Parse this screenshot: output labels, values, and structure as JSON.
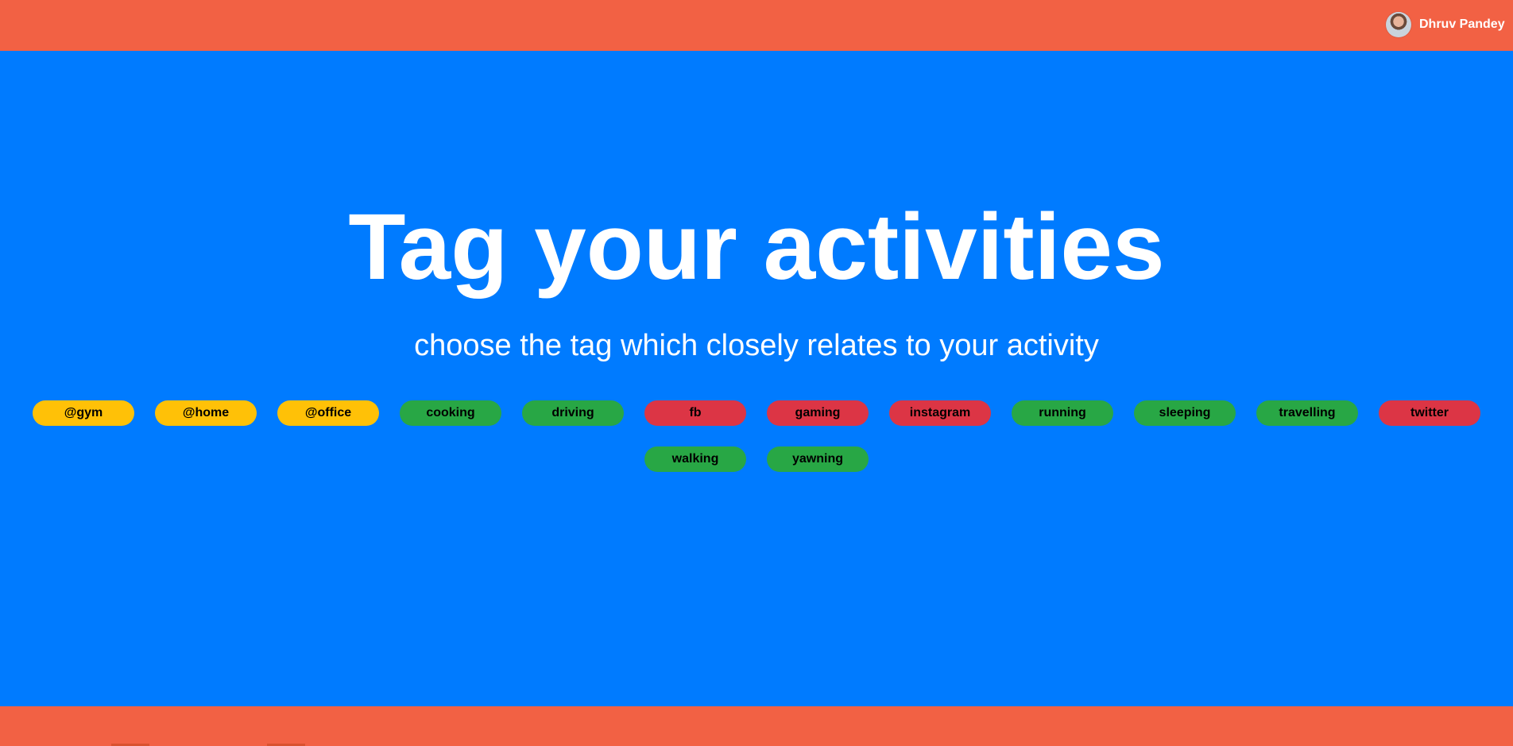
{
  "header": {
    "user_name": "Dhruv Pandey",
    "avatar_icon": "user-avatar"
  },
  "hero": {
    "title": "Tag your activities",
    "subtitle": "choose the tag which closely relates to your activity"
  },
  "tags": [
    {
      "label": "@gym",
      "color": "#ffc107"
    },
    {
      "label": "@home",
      "color": "#ffc107"
    },
    {
      "label": "@office",
      "color": "#ffc107"
    },
    {
      "label": "cooking",
      "color": "#28a745"
    },
    {
      "label": "driving",
      "color": "#28a745"
    },
    {
      "label": "fb",
      "color": "#dc3545"
    },
    {
      "label": "gaming",
      "color": "#dc3545"
    },
    {
      "label": "instagram",
      "color": "#dc3545"
    },
    {
      "label": "running",
      "color": "#28a745"
    },
    {
      "label": "sleeping",
      "color": "#28a745"
    },
    {
      "label": "travelling",
      "color": "#28a745"
    },
    {
      "label": "twitter",
      "color": "#dc3545"
    },
    {
      "label": "walking",
      "color": "#28a745"
    },
    {
      "label": "yawning",
      "color": "#28a745"
    }
  ],
  "colors": {
    "header_bg": "#f26144",
    "main_bg": "#007bff",
    "footer_bg": "#f26144",
    "tag_place": "#ffc107",
    "tag_positive": "#28a745",
    "tag_negative": "#dc3545",
    "text_light": "#ffffff"
  }
}
